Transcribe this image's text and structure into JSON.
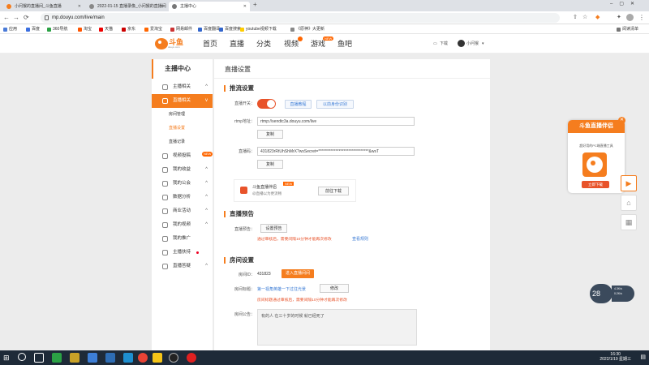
{
  "browser": {
    "tabs": [
      {
        "label": "小问猴的直播间_斗鱼直播"
      },
      {
        "label": "2022-01-15 直播录像_小问猴的直播间"
      },
      {
        "label": "主播中心"
      }
    ],
    "url": "mp.douyu.com/live/main",
    "bookmarks": [
      {
        "label": "应用"
      },
      {
        "label": "百度"
      },
      {
        "label": "360导航"
      },
      {
        "label": "淘宝"
      },
      {
        "label": "天猫"
      },
      {
        "label": "京东"
      },
      {
        "label": "爱淘宝"
      },
      {
        "label": "网易邮件"
      },
      {
        "label": "百度翻译"
      },
      {
        "label": "百度搜索"
      },
      {
        "label": "youtube视频下载"
      },
      {
        "label": "《原神》大更新"
      }
    ],
    "reading_list": "阅读清单"
  },
  "header": {
    "logo_text": "斗鱼",
    "logo_sub": "douyu.com",
    "nav": [
      "首页",
      "直播",
      "分类",
      "视频",
      "游戏",
      "鱼吧"
    ],
    "download": "下载",
    "username": "小问猴"
  },
  "sidebar": {
    "title": "主播中心",
    "items": [
      {
        "label": "主播相关"
      },
      {
        "label": "直播相关"
      },
      {
        "label": "视频投稿",
        "badge": "NEW"
      },
      {
        "label": "我的收益"
      },
      {
        "label": "我的公会"
      },
      {
        "label": "数据分析"
      },
      {
        "label": "商业活动"
      },
      {
        "label": "我的视频"
      },
      {
        "label": "我的推广"
      },
      {
        "label": "主播扶持"
      },
      {
        "label": "直播答疑"
      }
    ],
    "subitems": [
      {
        "label": "房间管理"
      },
      {
        "label": "直播设置"
      },
      {
        "label": "直播记录"
      }
    ]
  },
  "main": {
    "title": "直播设置",
    "stream": {
      "section": "推流设置",
      "switch_label": "直播开关：",
      "btn_tutorial": "直播教程",
      "btn_auth": "以前身份识别",
      "rtmp_label": "rtmp地址：",
      "rtmp_value": "rtmp://sendtc3a.douyu.com/live",
      "copy1": "复制",
      "code_label": "直播码：",
      "code_value": "431823rRtUhShMrX?wsSecret=********************************&wsT",
      "copy2": "复制"
    },
    "promo": {
      "title": "斗鱼直播伴侣",
      "new_badge": "NEW",
      "subtitle": "@直播以为更流畅",
      "btn": "前往下载"
    },
    "preview": {
      "section": "直播预告",
      "label": "直播预告：",
      "btn": "设置预告",
      "warning": "通过审核后，需要间隔10分钟才能再次修改",
      "link": "查看规则"
    },
    "room": {
      "section": "房间设置",
      "id_label": "房间ID：",
      "id_value": "431823",
      "enter_btn": "进入直播间间",
      "title_label": "房间标题：",
      "title_value": "第一视角英雄一下过往光景",
      "edit_btn": "修改",
      "title_warning": "房间标题通过审核后，需要间隔10分钟才能再次修改",
      "notice_label": "房间公告：",
      "notice_value": "有的人 在三十岁的时候 就已经死了"
    }
  },
  "float_card": {
    "title": "斗鱼直播伴侣",
    "sub": "超好用的PC端直播工具",
    "btn": "立即下载"
  },
  "orb": {
    "value": "28",
    "stat1": "4.3K/s",
    "stat2": "0.2K/s"
  },
  "taskbar": {
    "time": "16:30",
    "date": "2022/1/19 星期三"
  }
}
